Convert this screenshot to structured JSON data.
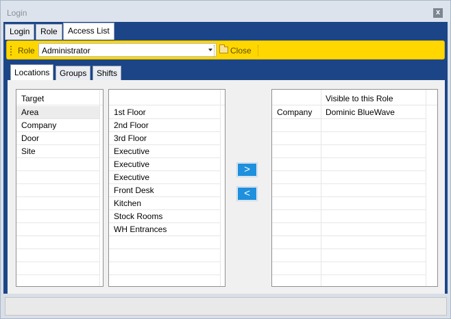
{
  "window": {
    "title": "Login",
    "close_glyph": "x"
  },
  "main_tabs": [
    {
      "label": "Login",
      "active": false
    },
    {
      "label": "Role",
      "active": false
    },
    {
      "label": "Access List",
      "active": true
    }
  ],
  "toolbar": {
    "role_label": "Role",
    "role_value": "Administrator",
    "close_label": "Close",
    "accent_color": "#ffd700"
  },
  "sub_tabs": [
    {
      "label": "Locations",
      "active": true
    },
    {
      "label": "Groups",
      "active": false
    },
    {
      "label": "Shifts",
      "active": false
    }
  ],
  "target_grid": {
    "header": "Target",
    "rows": [
      "Area",
      "Company",
      "Door",
      "Site"
    ],
    "selected_index": 0
  },
  "items_grid": {
    "rows": [
      "1st Floor",
      "2nd Floor",
      "3rd Floor",
      "Executive",
      "Executive",
      "Executive",
      "Front Desk",
      "Kitchen",
      "Stock Rooms",
      "WH Entrances"
    ]
  },
  "buttons": {
    "add_label": ">",
    "remove_label": "<"
  },
  "visible_grid": {
    "header": "Visible to this Role",
    "rows": [
      {
        "target": "Company",
        "name": "Dominic BlueWave"
      }
    ]
  },
  "colors": {
    "brand_blue": "#1c4587",
    "button_blue": "#1e90dd"
  }
}
